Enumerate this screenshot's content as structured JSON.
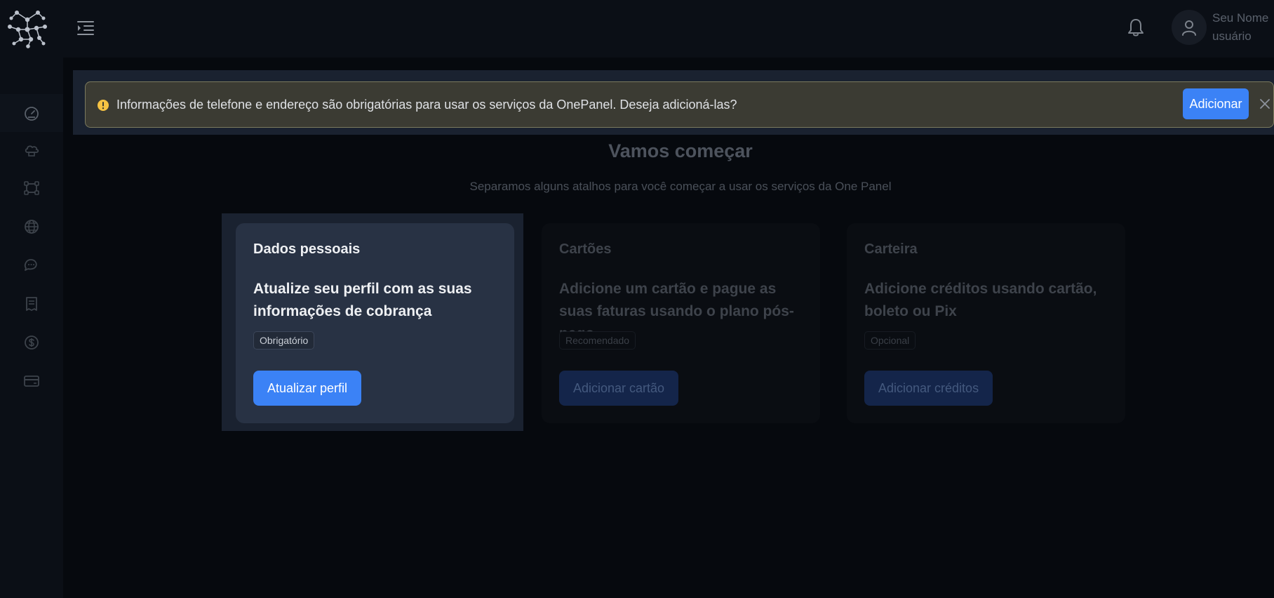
{
  "header": {
    "user_name": "Seu Nome",
    "user_role": "usuário",
    "icons": [
      "logo-icon",
      "menu-toggle-icon",
      "bell-icon",
      "user-icon"
    ]
  },
  "sidebar": {
    "items": [
      {
        "icon": "dashboard-icon",
        "active": true
      },
      {
        "icon": "cloud-server-icon",
        "active": false
      },
      {
        "icon": "network-icon",
        "active": false
      },
      {
        "icon": "globe-icon",
        "active": false
      },
      {
        "icon": "chat-icon",
        "active": false
      },
      {
        "icon": "invoice-icon",
        "active": false
      },
      {
        "icon": "dollar-icon",
        "active": false
      },
      {
        "icon": "credit-card-icon",
        "active": false
      }
    ]
  },
  "alert": {
    "message": "Informações de telefone e endereço são obrigatórias para usar os serviços da OnePanel. Deseja adicioná-las?",
    "action_label": "Adicionar",
    "icon": "warning-icon",
    "icon_color": "#f6c343"
  },
  "main": {
    "title": "Vamos começar",
    "subtitle": "Separamos alguns atalhos para você começar a usar os serviços da One Panel"
  },
  "cards": [
    {
      "title": "Dados pessoais",
      "description": "Atualize seu perfil com as suas informações de cobrança",
      "badge": "Obrigatório",
      "button": "Atualizar perfil",
      "state": "active"
    },
    {
      "title": "Cartões",
      "description": "Adicione um cartão e pague as suas faturas usando o plano pós-pago",
      "badge": "Recomendado",
      "button": "Adicionar cartão",
      "state": "dimmed"
    },
    {
      "title": "Carteira",
      "description": "Adicione créditos usando cartão, boleto ou Pix",
      "badge": "Opcional",
      "button": "Adicionar créditos",
      "state": "dimmed"
    }
  ],
  "colors": {
    "accent": "#3b82f6",
    "background": "#06090e",
    "card_active": "#283244"
  }
}
